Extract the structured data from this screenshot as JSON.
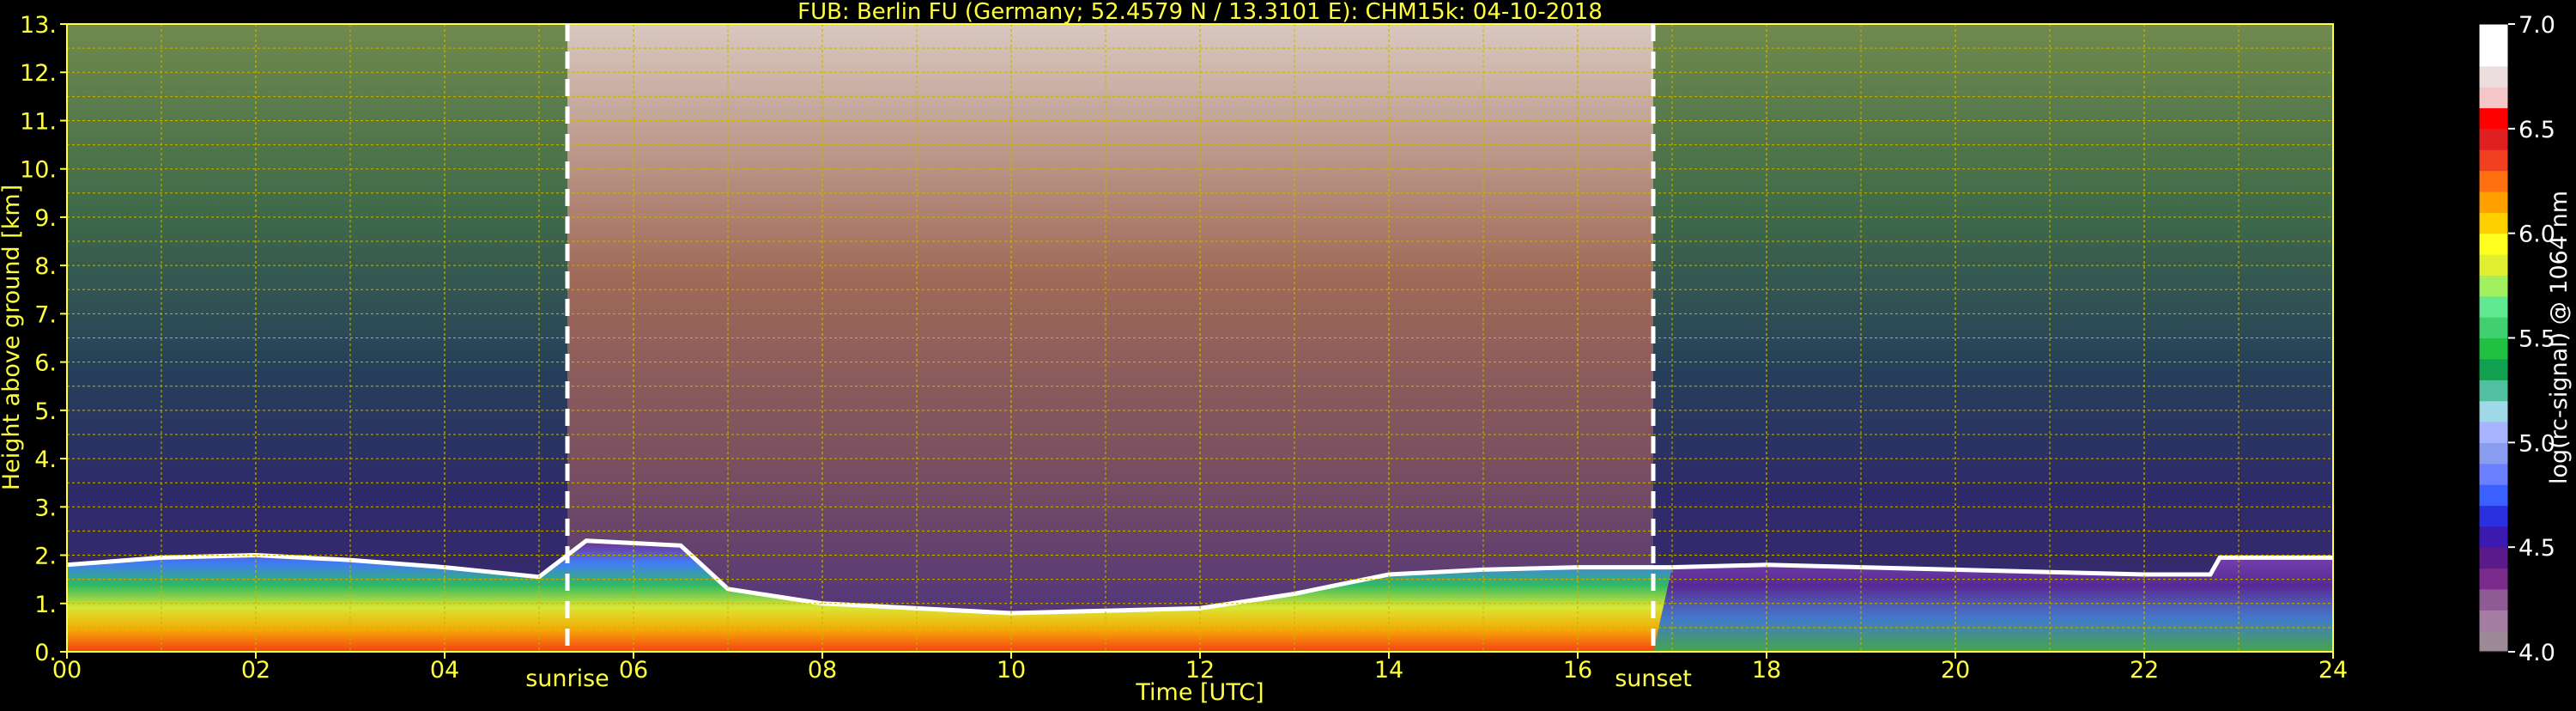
{
  "chart_data": {
    "type": "heatmap",
    "title": "FUB: Berlin FU (Germany; 52.4579 N / 13.3101 E):    CHM15k: 04-10-2018",
    "xlabel": "Time [UTC]",
    "ylabel": "Height above ground [km]",
    "xlim": [
      0,
      24
    ],
    "ylim": [
      0,
      13
    ],
    "x_ticks": [
      0,
      2,
      4,
      6,
      8,
      10,
      12,
      14,
      16,
      18,
      20,
      22,
      24
    ],
    "x_tick_labels": [
      "00",
      "02",
      "04",
      "06",
      "08",
      "10",
      "12",
      "14",
      "16",
      "18",
      "20",
      "22",
      "24"
    ],
    "y_ticks": [
      0,
      1,
      2,
      3,
      4,
      5,
      6,
      7,
      8,
      9,
      10,
      11,
      12,
      13
    ],
    "y_tick_labels": [
      "0.",
      "1.",
      "2.",
      "3.",
      "4.",
      "5.",
      "6.",
      "7.",
      "8.",
      "9.",
      "10.",
      "11.",
      "12.",
      "13."
    ],
    "grid": true,
    "annotations": [
      {
        "label": "sunrise",
        "x": 5.3
      },
      {
        "label": "sunset",
        "x": 16.8
      }
    ],
    "colorbar": {
      "label": "log(rc-signal) @ 1064 nm",
      "range": [
        4.0,
        7.0
      ],
      "ticks": [
        4.0,
        4.5,
        5.0,
        5.5,
        6.0,
        6.5,
        7.0
      ],
      "tick_labels": [
        "4.0",
        "4.5",
        "5.0",
        "5.5",
        "6.0",
        "6.5",
        "7.0"
      ],
      "colors": [
        "#9c8a99",
        "#a47ea2",
        "#8f5b95",
        "#7a2a8a",
        "#5a1a8a",
        "#3a1ab0",
        "#2a30e0",
        "#3a60ff",
        "#6a80ff",
        "#8a9cf0",
        "#a8b4ff",
        "#9fd8e6",
        "#50c0a0",
        "#10a050",
        "#20c040",
        "#40d070",
        "#60e890",
        "#a0f060",
        "#e0f030",
        "#ffff20",
        "#ffd000",
        "#ffa000",
        "#ff7010",
        "#f04020",
        "#e02020",
        "#ff0000",
        "#f4c6c8",
        "#ecdede",
        "#ffffff",
        "#ffffff"
      ]
    },
    "layers": {
      "boundary_layer_top_km": [
        [
          0,
          1.8
        ],
        [
          1,
          1.95
        ],
        [
          2,
          2.0
        ],
        [
          3,
          1.9
        ],
        [
          4,
          1.75
        ],
        [
          5,
          1.55
        ],
        [
          5.5,
          2.3
        ],
        [
          6.5,
          2.2
        ],
        [
          7,
          1.3
        ],
        [
          8,
          1.0
        ],
        [
          9,
          0.9
        ],
        [
          10,
          0.8
        ],
        [
          11,
          0.85
        ],
        [
          12,
          0.9
        ],
        [
          13,
          1.2
        ],
        [
          14,
          1.6
        ],
        [
          15,
          1.7
        ],
        [
          16,
          1.75
        ],
        [
          17,
          1.75
        ],
        [
          18,
          1.8
        ],
        [
          19,
          1.75
        ],
        [
          20,
          1.7
        ],
        [
          21,
          1.65
        ],
        [
          22,
          1.6
        ],
        [
          22.7,
          1.6
        ],
        [
          22.8,
          1.95
        ],
        [
          24,
          1.95
        ]
      ]
    }
  }
}
